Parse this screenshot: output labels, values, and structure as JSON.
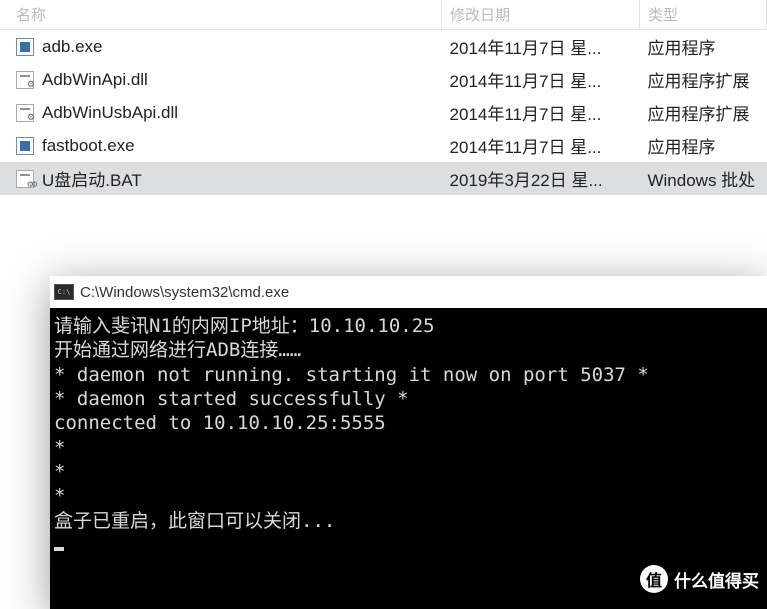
{
  "columns": {
    "name": "名称",
    "date": "修改日期",
    "type": "类型"
  },
  "files": [
    {
      "name": "adb.exe",
      "date": "2014年11月7日 星...",
      "type": "应用程序",
      "icon": "exe",
      "selected": false
    },
    {
      "name": "AdbWinApi.dll",
      "date": "2014年11月7日 星...",
      "type": "应用程序扩展",
      "icon": "dll",
      "selected": false
    },
    {
      "name": "AdbWinUsbApi.dll",
      "date": "2014年11月7日 星...",
      "type": "应用程序扩展",
      "icon": "dll",
      "selected": false
    },
    {
      "name": "fastboot.exe",
      "date": "2014年11月7日 星...",
      "type": "应用程序",
      "icon": "exe",
      "selected": false
    },
    {
      "name": "U盘启动.BAT",
      "date": "2019年3月22日 星...",
      "type": "Windows 批处",
      "icon": "bat",
      "selected": true
    }
  ],
  "cmd": {
    "title": "C:\\Windows\\system32\\cmd.exe",
    "lines": [
      "请输入斐讯N1的内网IP地址：10.10.10.25",
      "开始通过网络进行ADB连接……",
      "* daemon not running. starting it now on port 5037 *",
      "* daemon started successfully *",
      "connected to 10.10.10.25:5555",
      "*",
      "*",
      "*",
      "盒子已重启，此窗口可以关闭..."
    ]
  },
  "watermark": {
    "logo": "值",
    "text": "什么值得买"
  }
}
